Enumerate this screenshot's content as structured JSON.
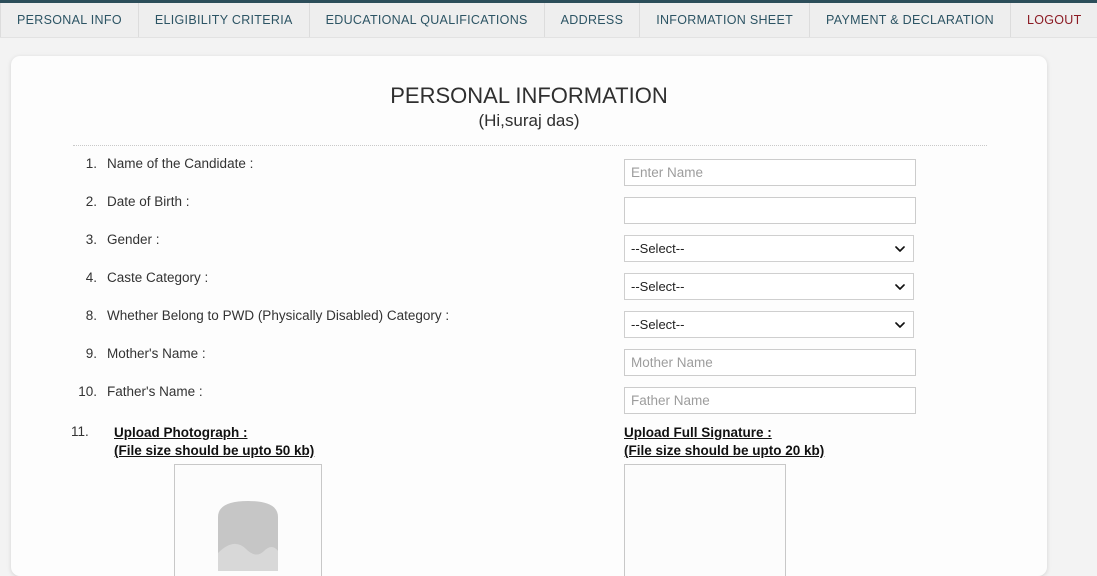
{
  "nav": {
    "items": [
      {
        "label": "PERSONAL INFO",
        "type": "link"
      },
      {
        "label": "ELIGIBILITY CRITERIA",
        "type": "link"
      },
      {
        "label": "EDUCATIONAL QUALIFICATIONS",
        "type": "link"
      },
      {
        "label": "ADDRESS",
        "type": "link"
      },
      {
        "label": "INFORMATION SHEET",
        "type": "link"
      },
      {
        "label": "PAYMENT & DECLARATION",
        "type": "link"
      },
      {
        "label": "LOGOUT",
        "type": "logout"
      }
    ],
    "accent_color": "#2c4e5a",
    "link_color": "#2c5464",
    "logout_color": "#8b1b24",
    "background": "#eeeeee"
  },
  "header": {
    "title": "PERSONAL INFORMATION",
    "greeting": "(Hi,suraj das)"
  },
  "form": {
    "rows": [
      {
        "num": "1.",
        "label": "Name of the Candidate :",
        "control": "text",
        "value": "",
        "placeholder": "Enter Name"
      },
      {
        "num": "2.",
        "label": "Date of Birth :",
        "control": "text",
        "value": "",
        "placeholder": ""
      },
      {
        "num": "3.",
        "label": "Gender :",
        "control": "select",
        "value": "--Select--"
      },
      {
        "num": "4.",
        "label": "Caste Category :",
        "control": "select",
        "value": "--Select--"
      },
      {
        "num": "8.",
        "label": "Whether Belong to PWD (Physically Disabled) Category :",
        "control": "select",
        "value": "--Select--"
      },
      {
        "num": "9.",
        "label": "Mother's Name :",
        "control": "text",
        "value": "",
        "placeholder": "Mother Name"
      },
      {
        "num": "10.",
        "label": "Father's Name :",
        "control": "text",
        "value": "",
        "placeholder": "Father Name"
      }
    ],
    "select_placeholder": "--Select--"
  },
  "upload": {
    "num": "11.",
    "photograph": {
      "title": "Upload Photograph :",
      "note": "(File size should be upto 50 kb)"
    },
    "signature": {
      "title": "Upload Full Signature :",
      "note": "(File size should be upto 20 kb)"
    }
  }
}
